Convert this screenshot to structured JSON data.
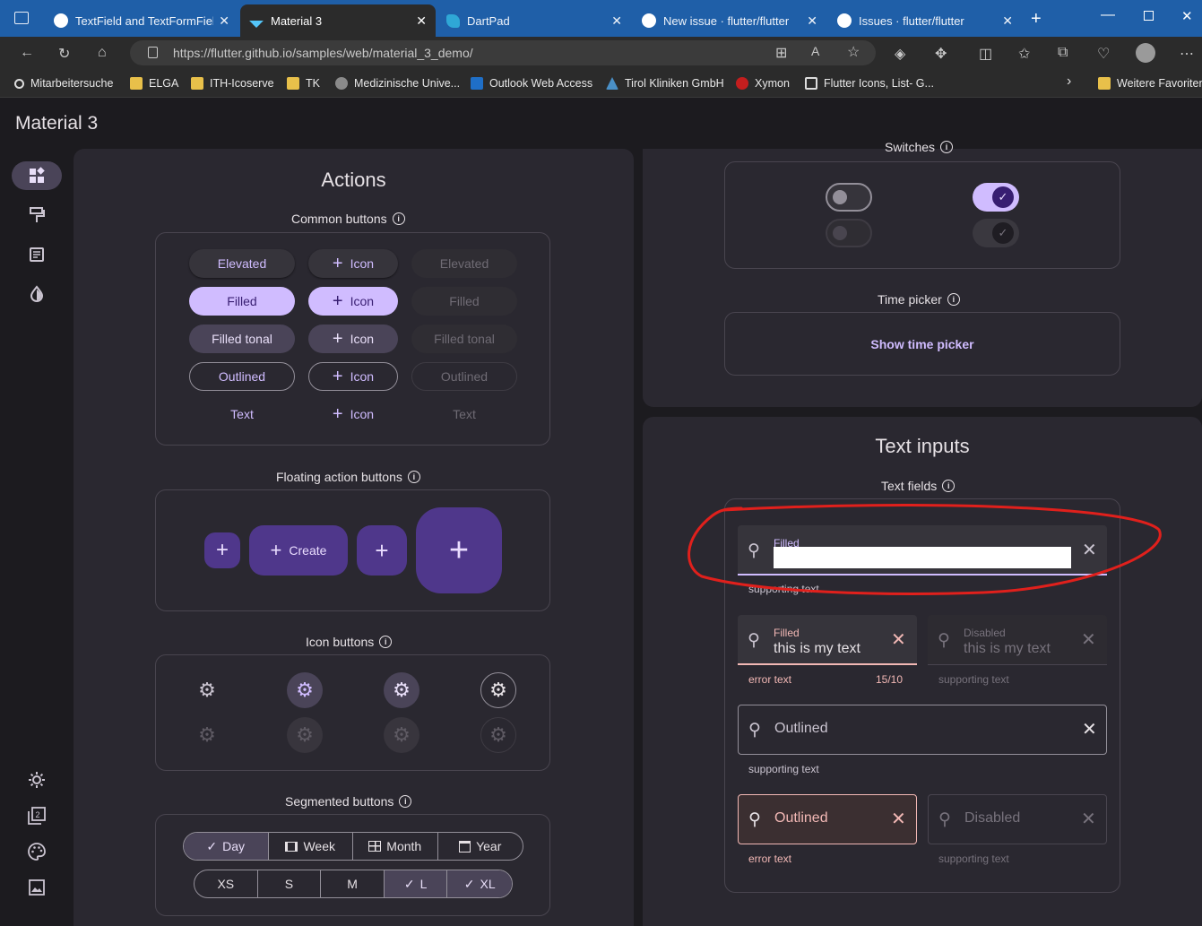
{
  "browser": {
    "tabs": [
      {
        "label": "TextField and TextFormField r",
        "icon": "github-icon",
        "active": false
      },
      {
        "label": "Material 3",
        "icon": "flutter-icon",
        "active": true
      },
      {
        "label": "DartPad",
        "icon": "dart-icon",
        "active": false
      },
      {
        "label": "New issue · flutter/flutter",
        "icon": "github-icon",
        "active": false
      },
      {
        "label": "Issues · flutter/flutter",
        "icon": "github-icon",
        "active": false
      }
    ],
    "url": "https://flutter.github.io/samples/web/material_3_demo/",
    "bookmarks": [
      {
        "label": "Mitarbeitersuche",
        "icon": "search-icon"
      },
      {
        "label": "ELGA",
        "icon": "folder-icon"
      },
      {
        "label": "ITH-Icoserve",
        "icon": "folder-icon"
      },
      {
        "label": "TK",
        "icon": "folder-icon"
      },
      {
        "label": "Medizinische Unive...",
        "icon": "globe-icon"
      },
      {
        "label": "Outlook Web Access",
        "icon": "outlook-icon"
      },
      {
        "label": "Tirol Kliniken GmbH",
        "icon": "tirol-icon"
      },
      {
        "label": "Xymon",
        "icon": "xymon-icon"
      },
      {
        "label": "Flutter Icons, List- G...",
        "icon": "flutter-icons-icon"
      },
      {
        "label": "Weitere Favoriten",
        "icon": "folder-icon"
      }
    ]
  },
  "app": {
    "title": "Material 3"
  },
  "colors": {
    "primary": "#d0bcff",
    "surface": "#1c1b1f",
    "card": "#2a2830",
    "error": "#f2b8b5",
    "fab": "#4f378b",
    "annotation": "#e0201c"
  },
  "actions": {
    "title": "Actions",
    "common_buttons": {
      "heading": "Common buttons",
      "rows": [
        [
          "Elevated",
          "Icon",
          "Elevated"
        ],
        [
          "Filled",
          "Icon",
          "Filled"
        ],
        [
          "Filled tonal",
          "Icon",
          "Filled tonal"
        ],
        [
          "Outlined",
          "Icon",
          "Outlined"
        ],
        [
          "Text",
          "Icon",
          "Text"
        ]
      ]
    },
    "fab": {
      "heading": "Floating action buttons",
      "extended_label": "Create"
    },
    "icon_buttons": {
      "heading": "Icon buttons"
    },
    "segmented": {
      "heading": "Segmented buttons",
      "row1": [
        {
          "label": "Day",
          "selected": true,
          "icon": "calendar-view-day-icon"
        },
        {
          "label": "Week",
          "selected": false,
          "icon": "calendar-view-week-icon"
        },
        {
          "label": "Month",
          "selected": false,
          "icon": "calendar-view-month-icon"
        },
        {
          "label": "Year",
          "selected": false,
          "icon": "calendar-today-icon"
        }
      ],
      "row2": [
        {
          "label": "XS",
          "selected": false
        },
        {
          "label": "S",
          "selected": false
        },
        {
          "label": "M",
          "selected": false
        },
        {
          "label": "L",
          "selected": true
        },
        {
          "label": "XL",
          "selected": true
        }
      ]
    }
  },
  "switches": {
    "heading": "Switches"
  },
  "time_picker": {
    "heading": "Time picker",
    "button": "Show time picker"
  },
  "text_inputs": {
    "title": "Text inputs",
    "heading": "Text fields",
    "filled_focused": {
      "label": "Filled",
      "value": "",
      "helper": "supporting text"
    },
    "filled_error": {
      "label": "Filled",
      "value": "this is my text",
      "helper": "error text",
      "counter": "15/10"
    },
    "filled_disabled": {
      "label": "Disabled",
      "value": "this is my text",
      "helper": "supporting text"
    },
    "outlined": {
      "label": "Outlined",
      "helper": "supporting text"
    },
    "outlined_error": {
      "label": "Outlined",
      "helper": "error text"
    },
    "outlined_disabled": {
      "label": "Disabled",
      "helper": "supporting text"
    }
  }
}
